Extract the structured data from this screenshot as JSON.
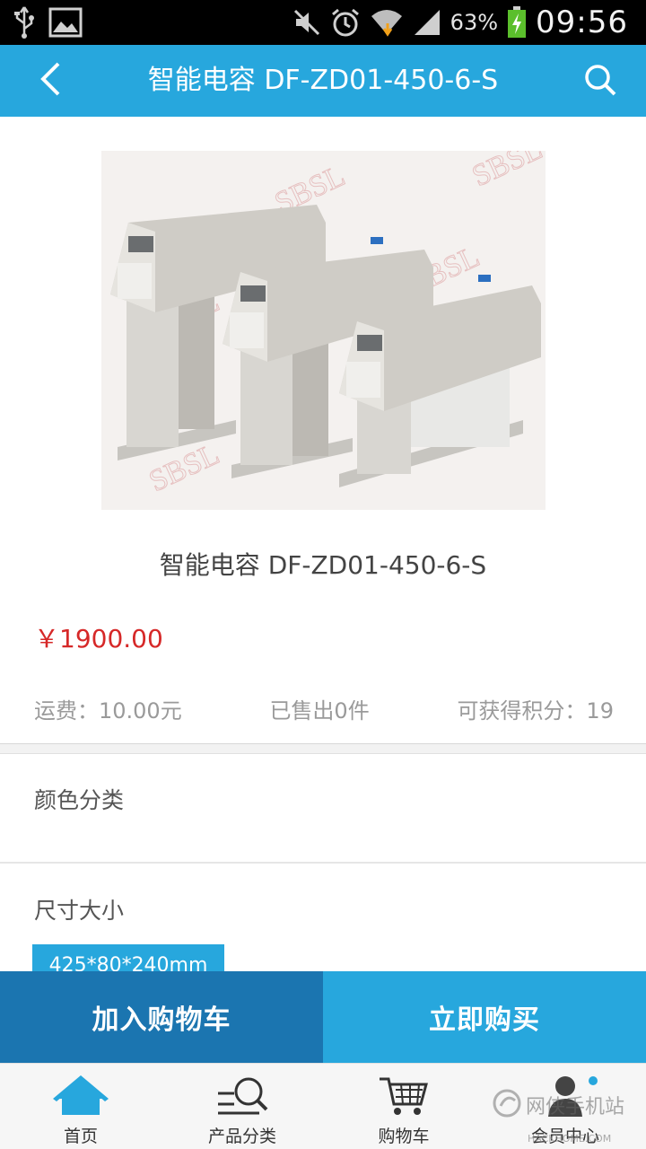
{
  "status_bar": {
    "battery_percent": "63%",
    "time": "09:56",
    "icons": [
      "usb-icon",
      "image-icon",
      "mute-icon",
      "alarm-icon",
      "wifi-icon",
      "signal-icon",
      "battery-charging-icon"
    ]
  },
  "header": {
    "title": "智能电容 DF-ZD01-450-6-S",
    "back_icon": "chevron-left-icon",
    "search_icon": "search-icon"
  },
  "product": {
    "name": "智能电容 DF-ZD01-450-6-S",
    "price": "￥1900.00",
    "shipping": "运费：10.00元",
    "sold": "已售出0件",
    "points": "可获得积分：19",
    "watermark_text": "SBSL"
  },
  "options": {
    "color_label": "颜色分类",
    "size_label": "尺寸大小",
    "size_values": [
      "425*80*240mm"
    ]
  },
  "actions": {
    "add_to_cart": "加入购物车",
    "buy_now": "立即购买"
  },
  "bottom_nav": {
    "items": [
      {
        "label": "首页",
        "icon": "home-icon",
        "active": true
      },
      {
        "label": "产品分类",
        "icon": "category-search-icon",
        "active": false
      },
      {
        "label": "购物车",
        "icon": "cart-icon",
        "active": false
      },
      {
        "label": "会员中心",
        "icon": "member-icon",
        "active": false
      }
    ]
  },
  "overlay_watermark": {
    "text": "网侠手机站",
    "sub": "HACKHOME.COM"
  },
  "colors": {
    "primary": "#27a7dd",
    "primary_dark": "#1b75b0",
    "price_red": "#d62828"
  }
}
